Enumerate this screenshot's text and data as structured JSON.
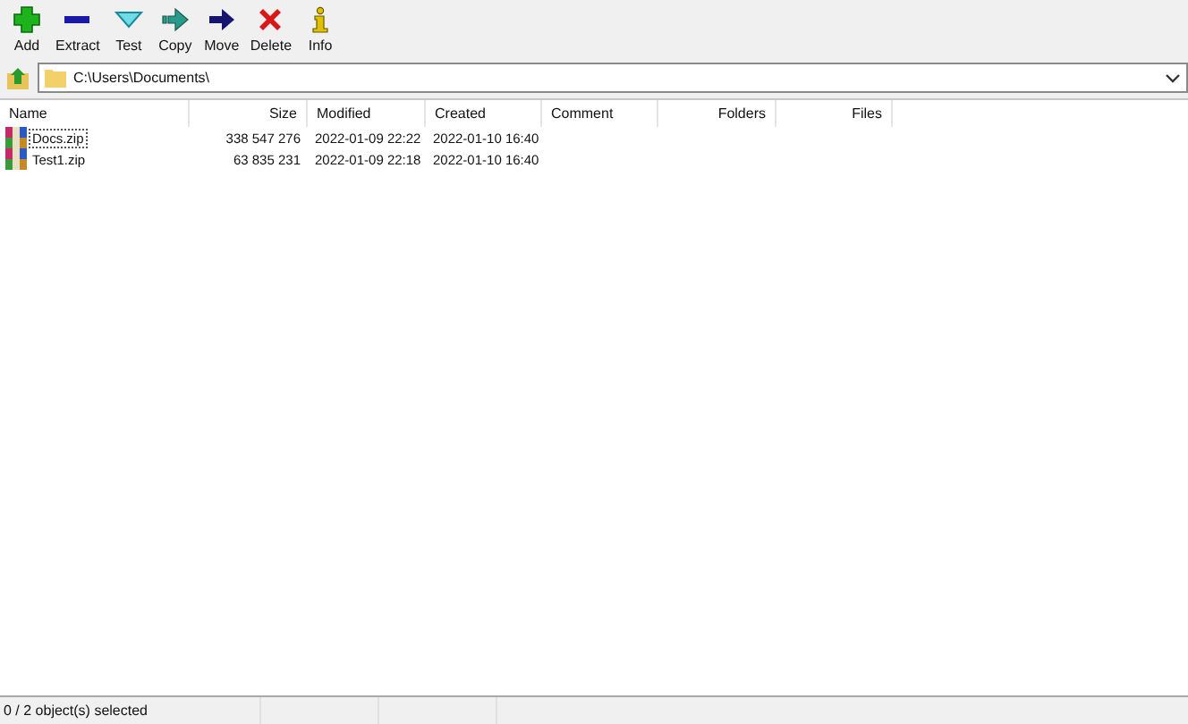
{
  "toolbar": [
    {
      "label": "Add",
      "kind": "add"
    },
    {
      "label": "Extract",
      "kind": "extract"
    },
    {
      "label": "Test",
      "kind": "test"
    },
    {
      "label": "Copy",
      "kind": "copy"
    },
    {
      "label": "Move",
      "kind": "move"
    },
    {
      "label": "Delete",
      "kind": "delete"
    },
    {
      "label": "Info",
      "kind": "info"
    }
  ],
  "address": {
    "value": "C:\\Users\\Documents\\"
  },
  "table": {
    "columns": [
      "Name",
      "Size",
      "Modified",
      "Created",
      "Comment",
      "Folders",
      "Files"
    ],
    "rows": [
      {
        "name": "Docs.zip",
        "size": "338 547 276",
        "modified": "2022-01-09 22:22",
        "created": "2022-01-10 16:40",
        "focused": true
      },
      {
        "name": "Test1.zip",
        "size": "63 835 231",
        "modified": "2022-01-09 22:18",
        "created": "2022-01-10 16:40",
        "focused": false
      }
    ]
  },
  "status_bar": "0 / 2 object(s) selected"
}
